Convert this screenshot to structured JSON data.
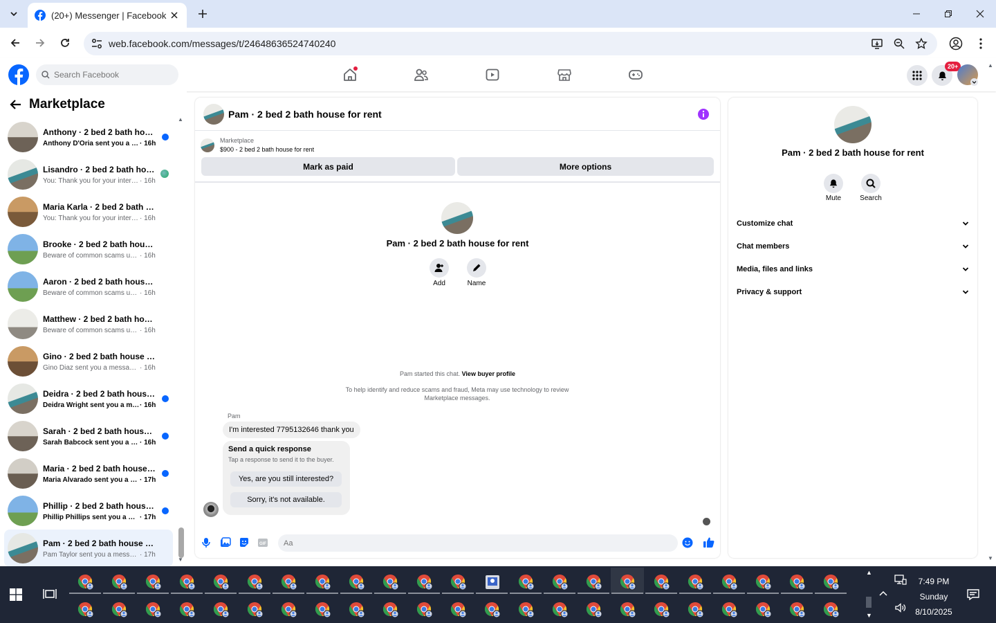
{
  "browser": {
    "tab_title": "(20+) Messenger | Facebook",
    "url": "web.facebook.com/messages/t/24648636524740240"
  },
  "fb": {
    "search_placeholder": "Search Facebook",
    "notif_badge": "20+"
  },
  "left": {
    "title": "Marketplace",
    "conversations": [
      {
        "name": "Anthony · 2 bed 2 bath house...",
        "preview": "Anthony D'Oria sent you a me...",
        "time": "· 16h",
        "unread": true
      },
      {
        "name": "Lisandro · 2 bed 2 bath hous...",
        "preview": "You: Thank you for your intere...",
        "time": "· 16h",
        "unread": false
      },
      {
        "name": "Maria Karla · 2 bed 2 bath hous...",
        "preview": "You: Thank you for your interest. ...",
        "time": "· 16h",
        "unread": false
      },
      {
        "name": "Brooke · 2 bed 2 bath house for...",
        "preview": "Beware of common scams using ...",
        "time": "· 16h",
        "unread": false
      },
      {
        "name": "Aaron · 2 bed 2 bath house for ...",
        "preview": "Beware of common scams using ...",
        "time": "· 16h",
        "unread": false
      },
      {
        "name": "Matthew · 2 bed 2 bath house f...",
        "preview": "Beware of common scams using ...",
        "time": "· 16h",
        "unread": false
      },
      {
        "name": "Gino · 2 bed 2 bath house for r...",
        "preview": "Gino Diaz sent you a message ab...",
        "time": "· 16h",
        "unread": false
      },
      {
        "name": "Deidra · 2 bed 2 bath house f...",
        "preview": "Deidra Wright sent you a mes...",
        "time": "· 16h",
        "unread": true
      },
      {
        "name": "Sarah · 2 bed 2 bath house fo...",
        "preview": "Sarah Babcock sent you a mes...",
        "time": "· 16h",
        "unread": true
      },
      {
        "name": "Maria · 2 bed 2 bath house fo...",
        "preview": "Maria Alvarado sent you a me...",
        "time": "· 17h",
        "unread": true
      },
      {
        "name": "Phillip · 2 bed 2 bath house fo...",
        "preview": "Phillip Phillips sent you a mes...",
        "time": "· 17h",
        "unread": true
      },
      {
        "name": "Pam · 2 bed 2 bath house for rent",
        "preview": "Pam Taylor sent you a message a...",
        "time": "· 17h",
        "unread": false
      }
    ]
  },
  "chat": {
    "title": "Pam · 2 bed 2 bath house for rent",
    "listing_label": "Marketplace",
    "listing_price": "$900 - 2 bed 2 bath house for rent",
    "mark_paid": "Mark as paid",
    "more_options": "More options",
    "center_name": "Pam · 2 bed 2 bath house for rent",
    "add_label": "Add",
    "name_label": "Name",
    "started_text": "Pam started this chat.",
    "view_profile": "View buyer profile",
    "disclaimer": "To help identify and reduce scams and fraud, Meta may use technology to review Marketplace messages.",
    "sender": "Pam",
    "message": "I'm interested 7795132646 thank you",
    "quick_title": "Send a quick response",
    "quick_sub": "Tap a response to send it to the buyer.",
    "quick_1": "Yes, are you still interested?",
    "quick_2": "Sorry, it's not available.",
    "input_placeholder": "Aa"
  },
  "right": {
    "name": "Pam · 2 bed 2 bath house for rent",
    "mute": "Mute",
    "search": "Search",
    "rows": [
      "Customize chat",
      "Chat members",
      "Media, files and links",
      "Privacy & support"
    ]
  },
  "taskbar": {
    "time": "7:49 PM",
    "day": "Sunday",
    "date": "8/10/2025"
  }
}
